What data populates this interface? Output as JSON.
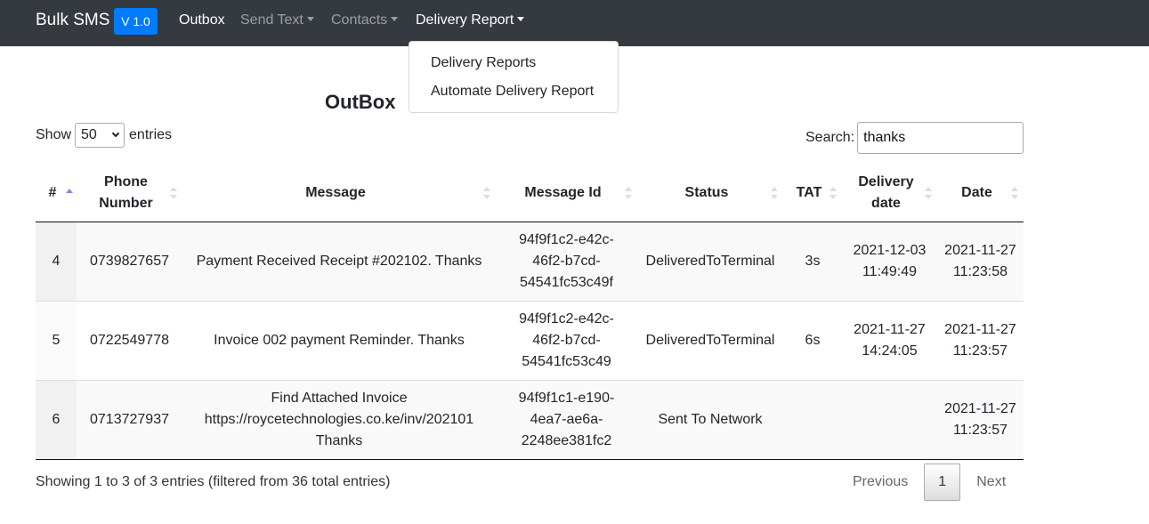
{
  "navbar": {
    "brand": "Bulk SMS",
    "version": "V 1.0",
    "items": [
      {
        "label": "Outbox",
        "active": true,
        "dropdown": false
      },
      {
        "label": "Send Text",
        "active": false,
        "dropdown": true
      },
      {
        "label": "Contacts",
        "active": false,
        "dropdown": true
      },
      {
        "label": "Delivery Report",
        "active": true,
        "dropdown": true
      }
    ],
    "open_dropdown": {
      "parent": "Delivery Report",
      "items": [
        "Delivery Reports",
        "Automate Delivery Report"
      ]
    }
  },
  "page": {
    "title": "OutBox"
  },
  "controls": {
    "show_label": "Show",
    "entries_label": "entries",
    "page_length": "50",
    "search_label": "Search:",
    "search_value": "thanks"
  },
  "table": {
    "columns": [
      "#",
      "Phone Number",
      "Message",
      "Message Id",
      "Status",
      "TAT",
      "Delivery date",
      "Date"
    ],
    "sorted_column": "#",
    "sort_direction": "asc",
    "rows": [
      {
        "num": "4",
        "phone": "0739827657",
        "message": "Payment Received Receipt #202102. Thanks",
        "message_id": "94f9f1c2-e42c-46f2-b7cd-54541fc53c49f",
        "status": "DeliveredToTerminal",
        "tat": "3s",
        "delivery_date": "2021-12-03 11:49:49",
        "date": "2021-11-27 11:23:58"
      },
      {
        "num": "5",
        "phone": "0722549778",
        "message": "Invoice 002 payment Reminder. Thanks",
        "message_id": "94f9f1c2-e42c-46f2-b7cd-54541fc53c49",
        "status": "DeliveredToTerminal",
        "tat": "6s",
        "delivery_date": "2021-11-27 14:24:05",
        "date": "2021-11-27 11:23:57"
      },
      {
        "num": "6",
        "phone": "0713727937",
        "message": "Find Attached Invoice https://roycetechnologies.co.ke/inv/202101 Thanks",
        "message_id": "94f9f1c1-e190-4ea7-ae6a-2248ee381fc2",
        "status": "Sent To Network",
        "tat": "",
        "delivery_date": "",
        "date": "2021-11-27 11:23:57"
      }
    ]
  },
  "footer": {
    "info": "Showing 1 to 3 of 3 entries (filtered from 36 total entries)",
    "previous_label": "Previous",
    "current_page": "1",
    "next_label": "Next"
  },
  "colors": {
    "navbar_bg": "#343a40",
    "badge_bg": "#007bff",
    "sort_active": "#8b80e8"
  }
}
